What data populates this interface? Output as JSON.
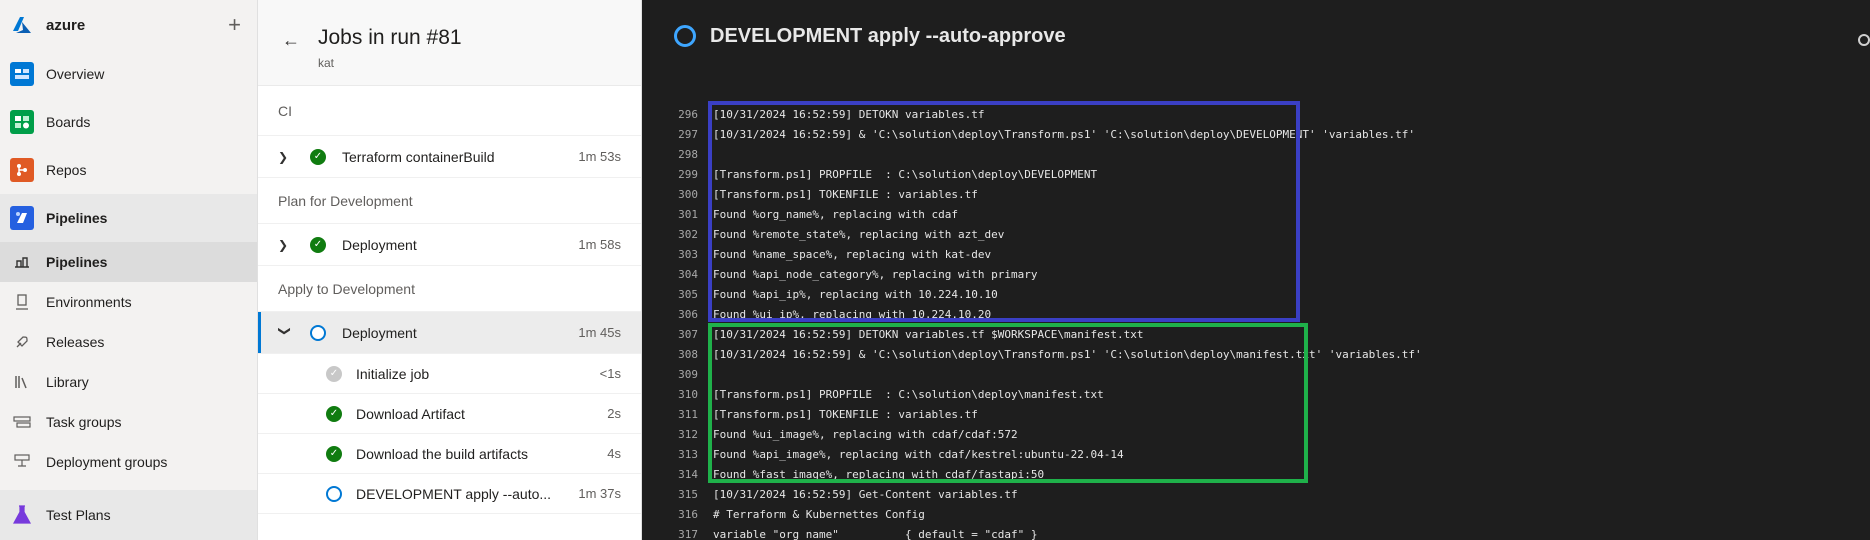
{
  "nav": {
    "org": "azure",
    "items": [
      {
        "label": "Overview",
        "icon": "overview-icon",
        "color": "#0078d4"
      },
      {
        "label": "Boards",
        "icon": "boards-icon",
        "color": "#009e49"
      },
      {
        "label": "Repos",
        "icon": "repos-icon",
        "color": "#e05a24"
      }
    ],
    "pipelines_section": {
      "label": "Pipelines",
      "icon": "pipelines-icon",
      "color": "#2560e0"
    },
    "sub_items": [
      {
        "label": "Pipelines",
        "icon": "pipelines-sub-icon",
        "active": true
      },
      {
        "label": "Environments",
        "icon": "environments-icon"
      },
      {
        "label": "Releases",
        "icon": "releases-icon"
      },
      {
        "label": "Library",
        "icon": "library-icon"
      },
      {
        "label": "Task groups",
        "icon": "task-groups-icon"
      },
      {
        "label": "Deployment groups",
        "icon": "deployment-groups-icon"
      }
    ],
    "test_plans": {
      "label": "Test Plans",
      "icon": "test-plans-icon",
      "color": "#773adc"
    }
  },
  "jobs": {
    "title": "Jobs in run #81",
    "subtitle": "kat",
    "stages": [
      {
        "name": "CI",
        "jobs": [
          {
            "name": "Terraform containerBuild",
            "duration": "1m 53s",
            "status": "success"
          }
        ]
      },
      {
        "name": "Plan for Development",
        "jobs": [
          {
            "name": "Deployment",
            "duration": "1m 58s",
            "status": "success"
          }
        ]
      },
      {
        "name": "Apply to Development",
        "jobs": [
          {
            "name": "Deployment",
            "duration": "1m 45s",
            "status": "running",
            "expanded": true
          }
        ]
      }
    ],
    "steps": [
      {
        "name": "Initialize job",
        "duration": "<1s",
        "status": "skipped"
      },
      {
        "name": "Download Artifact",
        "duration": "2s",
        "status": "success"
      },
      {
        "name": "Download the build artifacts",
        "duration": "4s",
        "status": "success"
      },
      {
        "name": "DEVELOPMENT apply --auto...",
        "duration": "1m 37s",
        "status": "running"
      }
    ]
  },
  "log": {
    "title": "DEVELOPMENT apply --auto-approve",
    "lines": [
      {
        "n": "296",
        "t": "[10/31/2024 16:52:59] DETOKN variables.tf"
      },
      {
        "n": "297",
        "t": "[10/31/2024 16:52:59] & 'C:\\solution\\deploy\\Transform.ps1' 'C:\\solution\\deploy\\DEVELOPMENT' 'variables.tf'"
      },
      {
        "n": "298",
        "t": ""
      },
      {
        "n": "299",
        "t": "[Transform.ps1] PROPFILE  : C:\\solution\\deploy\\DEVELOPMENT"
      },
      {
        "n": "300",
        "t": "[Transform.ps1] TOKENFILE : variables.tf"
      },
      {
        "n": "301",
        "t": "Found %org_name%, replacing with cdaf"
      },
      {
        "n": "302",
        "t": "Found %remote_state%, replacing with azt_dev"
      },
      {
        "n": "303",
        "t": "Found %name_space%, replacing with kat-dev"
      },
      {
        "n": "304",
        "t": "Found %api_node_category%, replacing with primary"
      },
      {
        "n": "305",
        "t": "Found %api_ip%, replacing with 10.224.10.10"
      },
      {
        "n": "306",
        "t": "Found %ui_ip%, replacing with 10.224.10.20"
      },
      {
        "n": "307",
        "t": "[10/31/2024 16:52:59] DETOKN variables.tf $WORKSPACE\\manifest.txt"
      },
      {
        "n": "308",
        "t": "[10/31/2024 16:52:59] & 'C:\\solution\\deploy\\Transform.ps1' 'C:\\solution\\deploy\\manifest.txt' 'variables.tf'"
      },
      {
        "n": "309",
        "t": ""
      },
      {
        "n": "310",
        "t": "[Transform.ps1] PROPFILE  : C:\\solution\\deploy\\manifest.txt"
      },
      {
        "n": "311",
        "t": "[Transform.ps1] TOKENFILE : variables.tf"
      },
      {
        "n": "312",
        "t": "Found %ui_image%, replacing with cdaf/cdaf:572"
      },
      {
        "n": "313",
        "t": "Found %api_image%, replacing with cdaf/kestrel:ubuntu-22.04-14"
      },
      {
        "n": "314",
        "t": "Found %fast_image%, replacing with cdaf/fastapi:50"
      },
      {
        "n": "315",
        "t": "[10/31/2024 16:52:59] Get-Content variables.tf"
      },
      {
        "n": "316",
        "t": "# Terraform & Kubernettes Config"
      },
      {
        "n": "317",
        "t": "variable \"org_name\"          { default = \"cdaf\" }"
      }
    ]
  }
}
